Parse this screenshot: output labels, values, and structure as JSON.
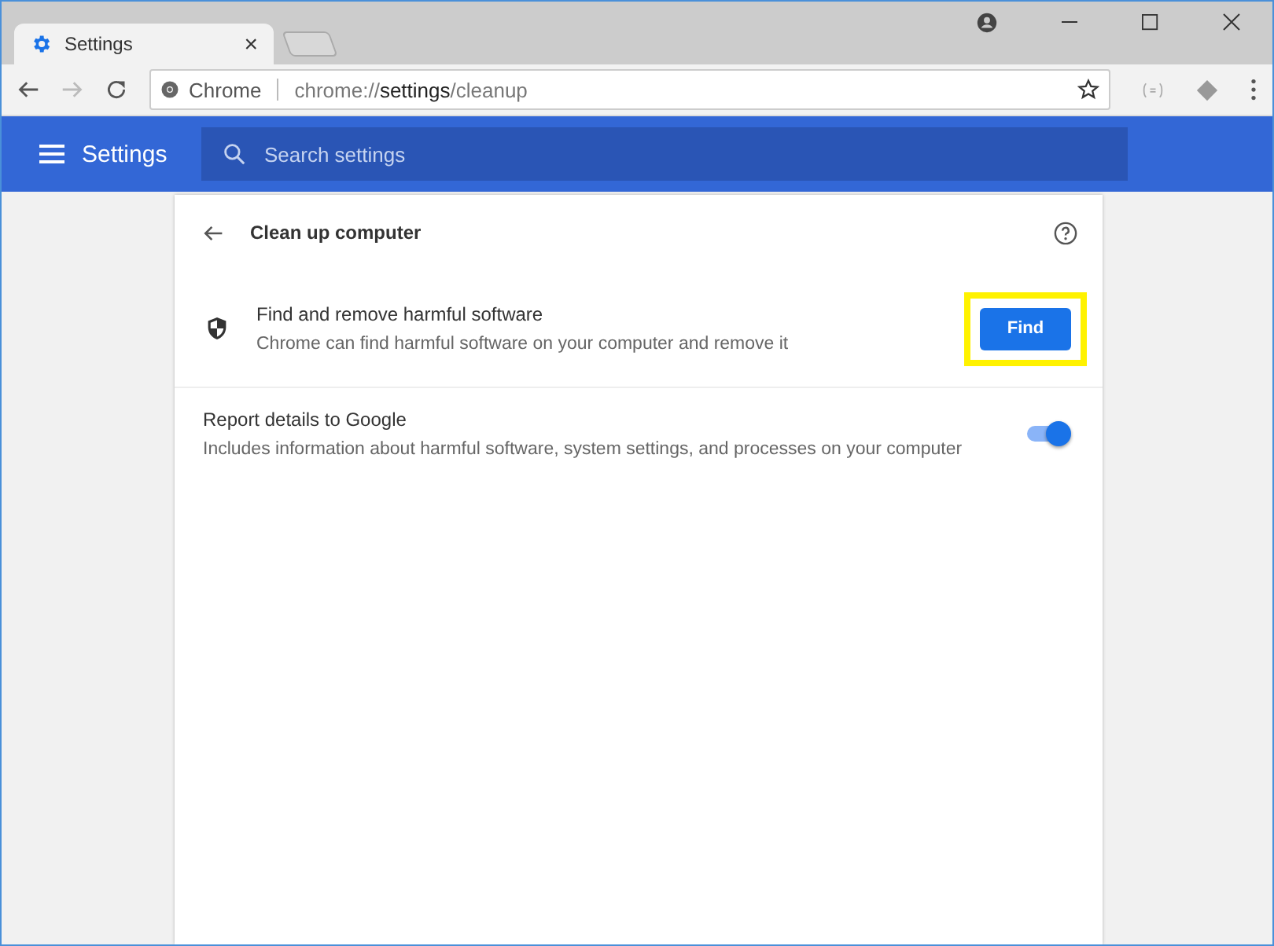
{
  "tabs": [
    {
      "title": "Settings",
      "close": "×",
      "selected": true
    }
  ],
  "address_bar": {
    "site_label": "Chrome",
    "url_scheme": "chrome://",
    "url_host": "settings",
    "url_path": "/cleanup"
  },
  "header": {
    "title": "Settings",
    "search": {
      "placeholder": "Search settings"
    }
  },
  "page": {
    "title": "Clean up computer",
    "rows": [
      {
        "kind": "action",
        "title": "Find and remove harmful software",
        "description": "Chrome can find harmful software on your computer and remove it",
        "button": {
          "label": "Find",
          "highlighted": true
        }
      },
      {
        "kind": "toggle",
        "title": "Report details to Google",
        "description": "Includes information about harmful software, system settings, and processes on your computer",
        "on": true
      }
    ]
  }
}
